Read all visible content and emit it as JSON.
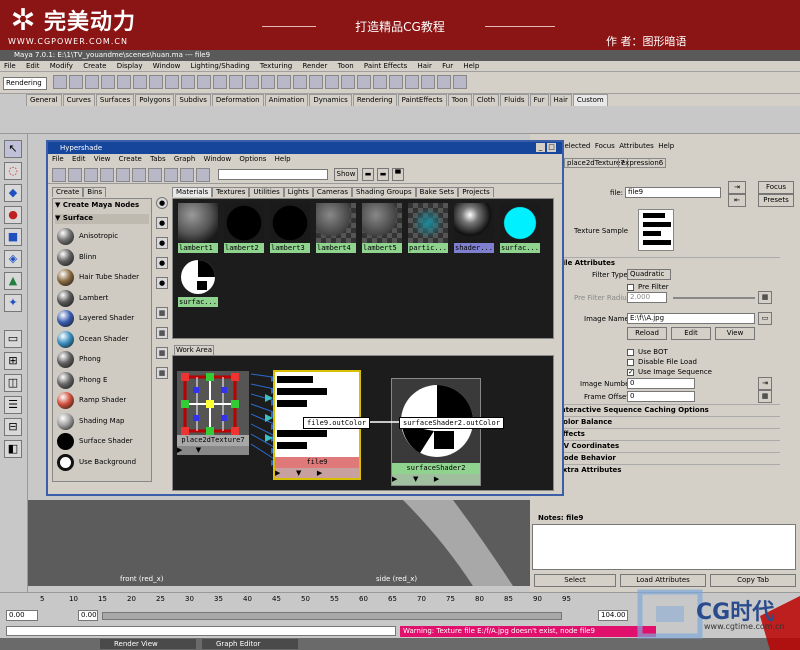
{
  "banner": {
    "logo_text": "完美动力",
    "logo_url": "WWW.CGPOWER.COM.CN",
    "slogan": "打造精品CG教程",
    "author": "作 者：图形暗语"
  },
  "maya": {
    "title": "Maya 7.0.1: E:\\1\\TV_youandme\\scenes\\huan.ma  ---  file9",
    "menu": [
      "File",
      "Edit",
      "Modify",
      "Create",
      "Display",
      "Window",
      "Lighting/Shading",
      "Texturing",
      "Render",
      "Toon",
      "Paint Effects",
      "Hair",
      "Fur",
      "Help"
    ],
    "mode": "Rendering",
    "shelf_tabs": [
      "General",
      "Curves",
      "Surfaces",
      "Polygons",
      "Subdivs",
      "Deformation",
      "Animation",
      "Dynamics",
      "Rendering",
      "PaintEffects",
      "Toon",
      "Cloth",
      "Fluids",
      "Fur",
      "Hair",
      "Custom"
    ],
    "shelf_active": "Custom"
  },
  "hypershade": {
    "title": "Hypershade",
    "menu": [
      "File",
      "Edit",
      "View",
      "Create",
      "Tabs",
      "Graph",
      "Window",
      "Options",
      "Help"
    ],
    "show_button": "Show",
    "left_tabs": [
      "Create",
      "Bins"
    ],
    "create_header": "Create Maya Nodes",
    "surface_header": "Surface",
    "nodes": [
      {
        "label": "Anisotropic",
        "color": "#707070"
      },
      {
        "label": "Blinn",
        "color": "#606060"
      },
      {
        "label": "Hair Tube Shader",
        "color": "#8a6a40"
      },
      {
        "label": "Lambert",
        "color": "#585858"
      },
      {
        "label": "Layered Shader",
        "color": "#3b5db0"
      },
      {
        "label": "Ocean Shader",
        "color": "#3b8fc0"
      },
      {
        "label": "Phong",
        "color": "#606060"
      },
      {
        "label": "Phong E",
        "color": "#666666"
      },
      {
        "label": "Ramp Shader",
        "color": "#d0503c"
      },
      {
        "label": "Shading Map",
        "color": "#a0a0a0"
      },
      {
        "label": "Surface Shader",
        "color": "#101010"
      },
      {
        "label": "Use Background",
        "color": "#ffffff"
      }
    ],
    "tabs": [
      "Materials",
      "Textures",
      "Utilities",
      "Lights",
      "Cameras",
      "Shading Groups",
      "Bake Sets",
      "Projects"
    ],
    "materials": [
      {
        "name": "lambert1",
        "kind": "gray"
      },
      {
        "name": "lambert2",
        "kind": "black"
      },
      {
        "name": "lambert3",
        "kind": "black"
      },
      {
        "name": "lambert4",
        "kind": "checkgray"
      },
      {
        "name": "lambert5",
        "kind": "checkgray"
      },
      {
        "name": "partic...",
        "kind": "particle"
      },
      {
        "name": "shader...",
        "kind": "shiny"
      },
      {
        "name": "surfac...",
        "kind": "cyan"
      },
      {
        "name": "surfac...",
        "kind": "bw"
      }
    ],
    "work_tab": "Work Area",
    "graph": {
      "place2d_label": "place2dTexture7",
      "file_label": "file9",
      "surface_label": "surfaceShader2",
      "tip_out": "file9.outColor",
      "tip_in": "surfaceShader2.outColor"
    }
  },
  "attribute_editor": {
    "tabs": [
      "place2dTexture7",
      "expression6"
    ],
    "menu": [
      "Selected",
      "Focus",
      "Attributes",
      "Help"
    ],
    "file_label": "file:",
    "file_value": "file9",
    "focus_button": "Focus",
    "presets_button": "Presets",
    "texture_sample_label": "Texture Sample",
    "section_file_attributes": "File Attributes",
    "filter_type_label": "Filter Type",
    "filter_type_value": "Quadratic",
    "pre_filter_label": "Pre Filter",
    "pre_filter_radius_label": "Pre Filter Radius",
    "pre_filter_radius_value": "2.000",
    "image_name_label": "Image Name",
    "image_name_value": "E:\\f\\\\A.jpg",
    "reload_button": "Reload",
    "edit_button": "Edit",
    "view_button": "View",
    "use_bot_label": "Use BOT",
    "disable_file_load_label": "Disable File Load",
    "use_image_sequence_label": "Use Image Sequence",
    "image_number_label": "Image Number",
    "image_number_value": "0",
    "frame_offset_label": "Frame Offset",
    "frame_offset_value": "0",
    "sections": [
      "Interactive Sequence Caching Options",
      "Color Balance",
      "Effects",
      "UV Coordinates",
      "Node Behavior",
      "Extra Attributes"
    ],
    "notes_label": "Notes: file9",
    "select_button": "Select",
    "load_attributes_button": "Load Attributes",
    "copy_tab_button": "Copy Tab"
  },
  "viewports": {
    "left_label": "front (red_x)",
    "right_label": "side (red_x)"
  },
  "timeline": {
    "ticks": [
      "5",
      "10",
      "15",
      "20",
      "25",
      "30",
      "35",
      "40",
      "45",
      "50",
      "55",
      "60",
      "65",
      "70",
      "75",
      "80",
      "85",
      "90",
      "95"
    ],
    "start": "0.00",
    "start2": "0.00",
    "end": "104.00"
  },
  "status": {
    "warning": "Warning: Texture file E:/f/A.jpg doesn't exist, node file9",
    "tasks": [
      "Render View",
      "Graph Editor"
    ]
  },
  "watermark": {
    "brand": "CG时代",
    "url": "www.cgtime.com.cn"
  }
}
